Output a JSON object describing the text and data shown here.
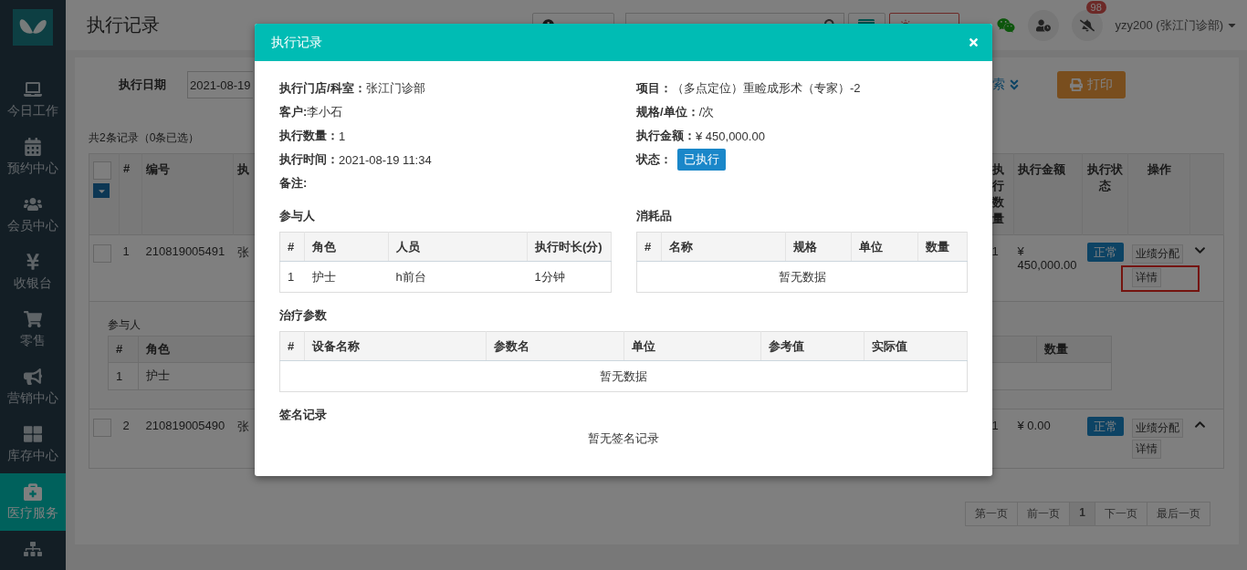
{
  "sidebar": {
    "items": [
      {
        "label": "今日工作",
        "selected": false
      },
      {
        "label": "预约中心",
        "selected": false
      },
      {
        "label": "会员中心",
        "selected": false
      },
      {
        "label": "收银台",
        "selected": false
      },
      {
        "label": "零售",
        "selected": false
      },
      {
        "label": "营销中心",
        "selected": false
      },
      {
        "label": "库存中心",
        "selected": false
      },
      {
        "label": "医疗服务",
        "selected": true
      }
    ]
  },
  "header": {
    "title": "执行记录",
    "notification_count": "98",
    "user": "yzy200 (张江门诊部)"
  },
  "filter": {
    "date_label": "执行日期",
    "date_value": "2021-08-19",
    "search_toggle": "索",
    "print_button": "打印"
  },
  "summary": "共2条记录（0条已选）",
  "table": {
    "header_checked": false,
    "columns_left": [
      "#",
      "编号",
      "执"
    ],
    "columns_right": [
      "执行数量",
      "执行金额",
      "执行状态",
      "操作"
    ],
    "rows": [
      {
        "checked": false,
        "index": "1",
        "number": "210819005491",
        "column_3": "张",
        "quantity": "1",
        "amount": "¥ 450,000.00",
        "status": "正常",
        "actions": [
          {
            "label": "业绩分配",
            "highlighted": false
          },
          {
            "label": "详情",
            "highlighted": true
          }
        ],
        "expanded": true,
        "detail": {
          "participants": {
            "title": "参与人",
            "columns": [
              "#",
              "角色"
            ],
            "rows": [
              [
                "1",
                "护士"
              ]
            ]
          },
          "consumables": {
            "columns": [
              "数量"
            ]
          }
        }
      },
      {
        "checked": false,
        "index": "2",
        "number": "210819005490",
        "column_3": "张",
        "quantity": "1",
        "amount": "¥ 0.00",
        "status": "正常",
        "actions": [
          {
            "label": "业绩分配",
            "highlighted": false
          },
          {
            "label": "详情",
            "highlighted": false
          }
        ],
        "expanded": false
      }
    ]
  },
  "pagination": [
    {
      "label": "第一页",
      "selected": false
    },
    {
      "label": "前一页",
      "selected": false
    },
    {
      "label": "1",
      "selected": true
    },
    {
      "label": "下一页",
      "selected": false
    },
    {
      "label": "最后一页",
      "selected": false
    }
  ],
  "modal": {
    "title": "执行记录",
    "fields_left": [
      {
        "label": "执行门店/科室：",
        "value": "张江门诊部",
        "kind": "text"
      },
      {
        "label": "客户:",
        "value": "李小石",
        "kind": "text"
      },
      {
        "label": "执行数量：",
        "value": "1",
        "kind": "text"
      },
      {
        "label": "执行时间：",
        "value": "2021-08-19 11:34",
        "kind": "text"
      },
      {
        "label": "备注:",
        "kind": "text"
      }
    ],
    "fields_right": [
      {
        "label": "项目：",
        "value": "（多点定位）重睑成形术（专家）-2",
        "kind": "text"
      },
      {
        "label": "规格/单位：",
        "value": "/次",
        "kind": "text"
      },
      {
        "label": "执行金额：",
        "value": "¥ 450,000.00",
        "kind": "text"
      },
      {
        "label": "状态：",
        "value": "已执行",
        "kind": "badge"
      }
    ],
    "participants": {
      "title": "参与人",
      "columns": [
        "#",
        "角色",
        "人员",
        "执行时长(分)"
      ],
      "rows": [
        [
          "1",
          "护士",
          "h前台",
          "1分钟"
        ]
      ]
    },
    "consumables": {
      "title": "消耗品",
      "columns": [
        "#",
        "名称",
        "规格",
        "单位",
        "数量"
      ],
      "empty": "暂无数据"
    },
    "treatment_params": {
      "title": "治疗参数",
      "columns": [
        "#",
        "设备名称",
        "参数名",
        "单位",
        "参考值",
        "实际值"
      ],
      "empty": "暂无数据"
    },
    "signatures": {
      "title": "签名记录",
      "empty": "暂无签名记录"
    }
  }
}
